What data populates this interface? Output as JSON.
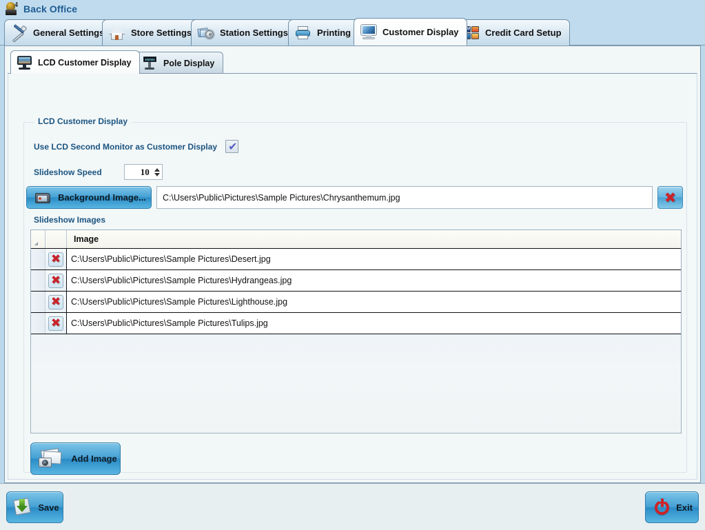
{
  "app": {
    "title": "Back Office",
    "logo_icon": "cashier-logo-icon",
    "logo_badge": "4"
  },
  "tabs": [
    {
      "label": "General Settings",
      "icon": "wrench-screwdriver-icon",
      "active": false
    },
    {
      "label": "Store Settings",
      "icon": "house-icon",
      "active": false
    },
    {
      "label": "Station Settings",
      "icon": "photos-gear-icon",
      "active": false
    },
    {
      "label": "Printing",
      "icon": "printer-icon",
      "active": false
    },
    {
      "label": "Customer Display",
      "icon": "monitor-icon",
      "active": true
    },
    {
      "label": "Credit Card Setup",
      "icon": "credit-cards-icon",
      "active": false
    }
  ],
  "subtabs": [
    {
      "label": "LCD Customer Display",
      "icon": "lcd-display-icon",
      "active": true
    },
    {
      "label": "Pole Display",
      "icon": "pole-display-icon",
      "active": false
    }
  ],
  "groupbox": {
    "title": "LCD Customer Display",
    "use_second_monitor": {
      "label": "Use LCD Second Monitor as Customer Display",
      "checked": true,
      "check_glyph": "✔"
    },
    "slideshow_speed": {
      "label": "Slideshow Speed",
      "value": "10"
    },
    "background_image": {
      "button_label": "Background Image...",
      "button_icon": "folder-image-icon",
      "path": "C:\\Users\\Public\\Pictures\\Sample Pictures\\Chrysanthemum.jpg",
      "clear_icon": "red-x-icon",
      "clear_glyph": "✖"
    },
    "slideshow_images_label": "Slideshow Images"
  },
  "grid": {
    "columns": [
      "",
      "",
      "Image"
    ],
    "header_image_label": "Image",
    "corner_icon": "sort-triangle-icon",
    "rows": [
      {
        "delete_icon": "red-x-icon",
        "delete_glyph": "✖",
        "path": "C:\\Users\\Public\\Pictures\\Sample Pictures\\Desert.jpg"
      },
      {
        "delete_icon": "red-x-icon",
        "delete_glyph": "✖",
        "path": "C:\\Users\\Public\\Pictures\\Sample Pictures\\Hydrangeas.jpg"
      },
      {
        "delete_icon": "red-x-icon",
        "delete_glyph": "✖",
        "path": "C:\\Users\\Public\\Pictures\\Sample Pictures\\Lighthouse.jpg"
      },
      {
        "delete_icon": "red-x-icon",
        "delete_glyph": "✖",
        "path": "C:\\Users\\Public\\Pictures\\Sample Pictures\\Tulips.jpg"
      }
    ]
  },
  "add_image": {
    "label": "Add Image",
    "icon": "photos-camera-icon"
  },
  "footer": {
    "save": {
      "label": "Save",
      "icon": "save-disk-icon"
    },
    "exit": {
      "label": "Exit",
      "icon": "power-icon"
    }
  },
  "colors": {
    "window_background": "#bcd9ec",
    "panel_background": "#f2f7f8",
    "accent_blue": "#1b5480",
    "title_blue": "#1f5c94",
    "button_blue": "#46a1d4",
    "danger_red": "#c9242b",
    "border": "#7e98ab"
  }
}
